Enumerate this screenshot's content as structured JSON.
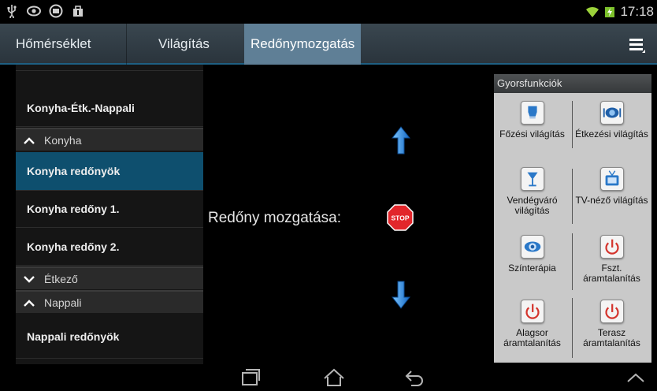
{
  "status_bar": {
    "left_icons": [
      "usb-icon",
      "eye-icon",
      "media-icon",
      "shop-icon"
    ],
    "right_icons": [
      "wifi-icon",
      "battery-icon"
    ],
    "time": "17:18"
  },
  "action_bar": {
    "tabs": [
      {
        "label": "Hőmérséklet",
        "active": false
      },
      {
        "label": "Világítás",
        "active": false
      },
      {
        "label": "Redőnymozgatás",
        "active": true
      }
    ],
    "menu_icon": "overflow-menu-icon"
  },
  "left_list": {
    "partial_top": "Konyha-Étk.-Nappali",
    "items": [
      {
        "type": "row",
        "label": "Konyha-Étk.-Nappali"
      },
      {
        "type": "header",
        "label": "Konyha",
        "expanded": true
      },
      {
        "type": "row",
        "label": "Konyha redőnyök",
        "selected": true
      },
      {
        "type": "row",
        "label": "Konyha redőny 1."
      },
      {
        "type": "row",
        "label": "Konyha redőny 2."
      },
      {
        "type": "header",
        "label": "Étkező",
        "expanded": false
      },
      {
        "type": "header",
        "label": "Nappali",
        "expanded": true
      },
      {
        "type": "row",
        "label": "Nappali redőnyök"
      }
    ]
  },
  "center": {
    "label": "Redőny mozgatása:",
    "up_icon": "arrow-up-icon",
    "stop_icon": "stop-icon",
    "stop_text": "STOP",
    "down_icon": "arrow-down-icon"
  },
  "quick_panel": {
    "title": "Gyorsfunkciók",
    "items": [
      {
        "label": "Főzési világítás",
        "icon": "cooking-light-icon"
      },
      {
        "label": "Étkezési világítás",
        "icon": "dining-light-icon"
      },
      {
        "label": "Vendégváró világítás",
        "icon": "guest-light-icon"
      },
      {
        "label": "TV-néző világítás",
        "icon": "tv-light-icon"
      },
      {
        "label": "Színterápia",
        "icon": "color-therapy-icon"
      },
      {
        "label": "Fszt. áramtalanítás",
        "icon": "power-off-icon"
      },
      {
        "label": "Alagsor áramtalanítás",
        "icon": "power-off-icon"
      },
      {
        "label": "Terasz áramtalanítás",
        "icon": "power-off-icon"
      }
    ]
  },
  "nav_bar": {
    "icons": [
      "recent-apps-icon",
      "home-icon",
      "back-icon",
      "expand-up-icon"
    ]
  },
  "colors": {
    "accent": "#5f7f96",
    "selected_row": "#0e4f6e",
    "arrow": "#1e88d8",
    "stop": "#e2262b"
  }
}
